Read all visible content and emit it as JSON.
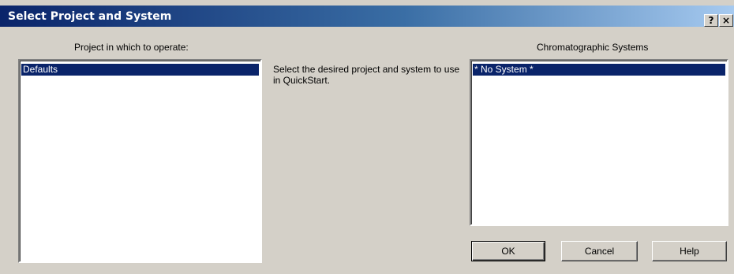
{
  "window": {
    "title": "Select Project and System",
    "help_glyph": "?",
    "close_glyph": "×"
  },
  "project": {
    "heading": "Project in which to operate:",
    "items": [
      "Defaults"
    ],
    "selected_index": 0
  },
  "description": "Select the desired project and system to use in QuickStart.",
  "systems": {
    "heading": "Chromatographic Systems",
    "items": [
      "* No System *"
    ],
    "selected_index": 0
  },
  "buttons": {
    "ok_label": "OK",
    "cancel_label": "Cancel",
    "help_label": "Help"
  },
  "colors": {
    "title_gradient_start": "#0a246a",
    "title_gradient_end": "#a6caf0",
    "selection": "#0a246a",
    "dialog_face": "#d4d0c8"
  }
}
